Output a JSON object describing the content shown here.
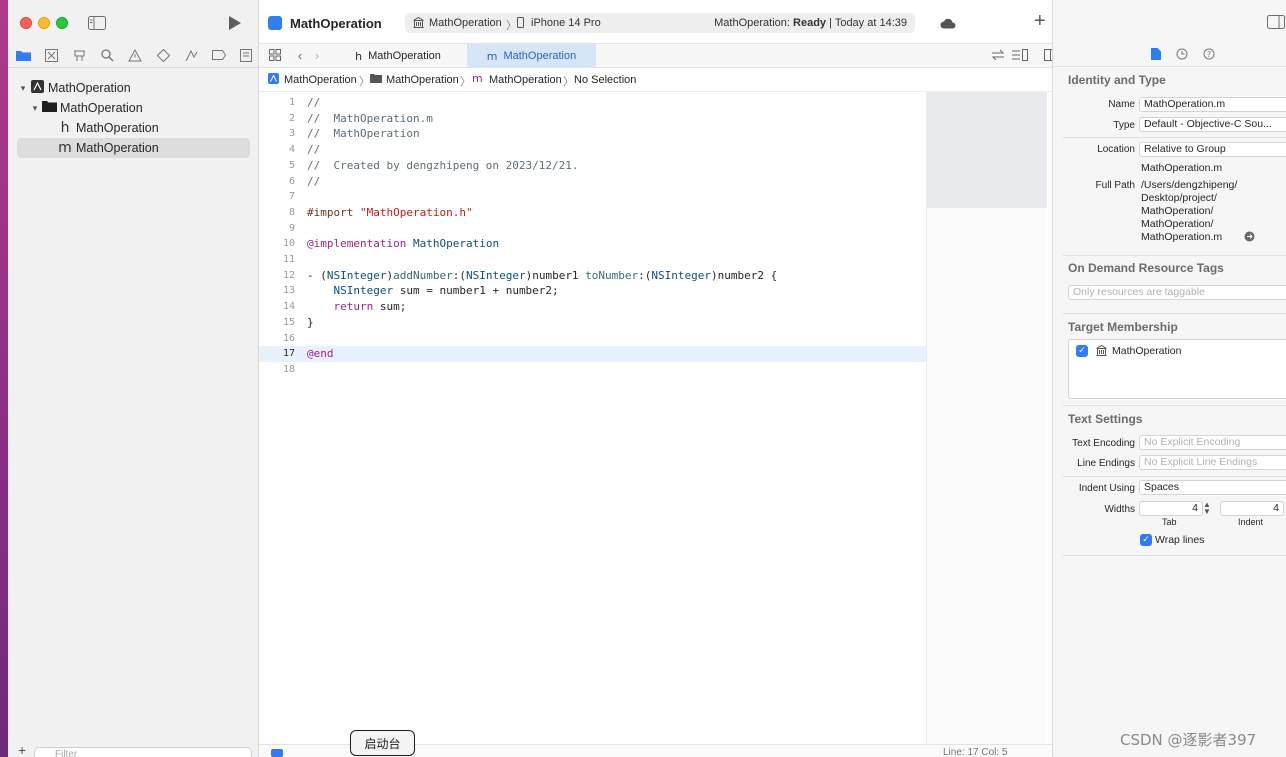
{
  "toolbar": {
    "scheme_name": "MathOperation",
    "destination_project": "MathOperation",
    "destination_device": "iPhone 14 Pro",
    "status_project": "MathOperation:",
    "status_state": "Ready",
    "status_time": "| Today at 14:39"
  },
  "navigator": {
    "tree": [
      {
        "label": "MathOperation",
        "type": "project",
        "expanded": true
      },
      {
        "label": "MathOperation",
        "type": "folder",
        "expanded": true
      },
      {
        "label": "MathOperation",
        "type": "header-file",
        "glyph": "h"
      },
      {
        "label": "MathOperation",
        "type": "implementation-file",
        "glyph": "m",
        "selected": true
      }
    ],
    "filter_placeholder": "Filter"
  },
  "editor": {
    "tabs": [
      {
        "label": "MathOperation",
        "glyph": "h",
        "active": false
      },
      {
        "label": "MathOperation",
        "glyph": "m",
        "active": true
      }
    ],
    "jumpbar": [
      "MathOperation",
      "MathOperation",
      "MathOperation",
      "No Selection"
    ],
    "current_line": 17,
    "lines": [
      {
        "n": "1",
        "tokens": [
          {
            "t": "//",
            "c": "comment"
          }
        ]
      },
      {
        "n": "2",
        "tokens": [
          {
            "t": "//  MathOperation.m",
            "c": "comment"
          }
        ]
      },
      {
        "n": "3",
        "tokens": [
          {
            "t": "//  MathOperation",
            "c": "comment"
          }
        ]
      },
      {
        "n": "4",
        "tokens": [
          {
            "t": "//",
            "c": "comment"
          }
        ]
      },
      {
        "n": "5",
        "tokens": [
          {
            "t": "//  Created by dengzhipeng on 2023/12/21.",
            "c": "comment"
          }
        ]
      },
      {
        "n": "6",
        "tokens": [
          {
            "t": "//",
            "c": "comment"
          }
        ]
      },
      {
        "n": "7",
        "tokens": []
      },
      {
        "n": "8",
        "tokens": [
          {
            "t": "#import ",
            "c": "pre"
          },
          {
            "t": "\"MathOperation.h\"",
            "c": "str"
          }
        ]
      },
      {
        "n": "9",
        "tokens": []
      },
      {
        "n": "10",
        "tokens": [
          {
            "t": "@implementation",
            "c": "kw"
          },
          {
            "t": " ",
            "c": "plain"
          },
          {
            "t": "MathOperation",
            "c": "type"
          }
        ]
      },
      {
        "n": "11",
        "tokens": []
      },
      {
        "n": "12",
        "tokens": [
          {
            "t": "- (",
            "c": "plain"
          },
          {
            "t": "NSInteger",
            "c": "type"
          },
          {
            "t": ")",
            "c": "plain"
          },
          {
            "t": "addNumber",
            "c": "method"
          },
          {
            "t": ":(",
            "c": "plain"
          },
          {
            "t": "NSInteger",
            "c": "type"
          },
          {
            "t": ")number1 ",
            "c": "plain"
          },
          {
            "t": "toNumber",
            "c": "method"
          },
          {
            "t": ":(",
            "c": "plain"
          },
          {
            "t": "NSInteger",
            "c": "type"
          },
          {
            "t": ")number2 {",
            "c": "plain"
          }
        ]
      },
      {
        "n": "13",
        "tokens": [
          {
            "t": "    ",
            "c": "plain"
          },
          {
            "t": "NSInteger",
            "c": "type"
          },
          {
            "t": " sum = number1 + number2;",
            "c": "plain"
          }
        ]
      },
      {
        "n": "14",
        "tokens": [
          {
            "t": "    ",
            "c": "plain"
          },
          {
            "t": "return",
            "c": "kw"
          },
          {
            "t": " sum;",
            "c": "plain"
          }
        ]
      },
      {
        "n": "15",
        "tokens": [
          {
            "t": "}",
            "c": "plain"
          }
        ]
      },
      {
        "n": "16",
        "tokens": []
      },
      {
        "n": "17",
        "tokens": [
          {
            "t": "@end",
            "c": "kw"
          }
        ]
      },
      {
        "n": "18",
        "tokens": []
      }
    ]
  },
  "statusbar": {
    "line_col": "Line: 17  Col: 5"
  },
  "tooltip": {
    "text": "启动台"
  },
  "inspector": {
    "identity_title": "Identity and Type",
    "name_label": "Name",
    "name_value": "MathOperation.m",
    "type_label": "Type",
    "type_value": "Default - Objective-C Sou...",
    "location_label": "Location",
    "location_value": "Relative to Group",
    "location_file": "MathOperation.m",
    "full_path_label": "Full Path",
    "full_path_lines": [
      "/Users/dengzhipeng/",
      "Desktop/project/",
      "MathOperation/",
      "MathOperation/",
      "MathOperation.m"
    ],
    "on_demand_title": "On Demand Resource Tags",
    "on_demand_placeholder": "Only resources are taggable",
    "target_title": "Target Membership",
    "target_name": "MathOperation",
    "target_checked": true,
    "text_settings_title": "Text Settings",
    "text_encoding_label": "Text Encoding",
    "text_encoding_value": "No Explicit Encoding",
    "line_endings_label": "Line Endings",
    "line_endings_value": "No Explicit Line Endings",
    "indent_using_label": "Indent Using",
    "indent_using_value": "Spaces",
    "widths_label": "Widths",
    "tab_width": "4",
    "indent_width": "4",
    "tab_caption": "Tab",
    "indent_caption": "Indent",
    "wrap_lines_label": "Wrap lines",
    "wrap_lines_checked": true
  },
  "watermark": {
    "text": "CSDN @逐影者397"
  },
  "colors": {
    "accent": "#2f7cf6",
    "selected_row": "#dcdcdc",
    "current_line": "#e8f2fc",
    "keyword": "#9b2393",
    "comment": "#5d6c79",
    "string": "#c41a16"
  }
}
